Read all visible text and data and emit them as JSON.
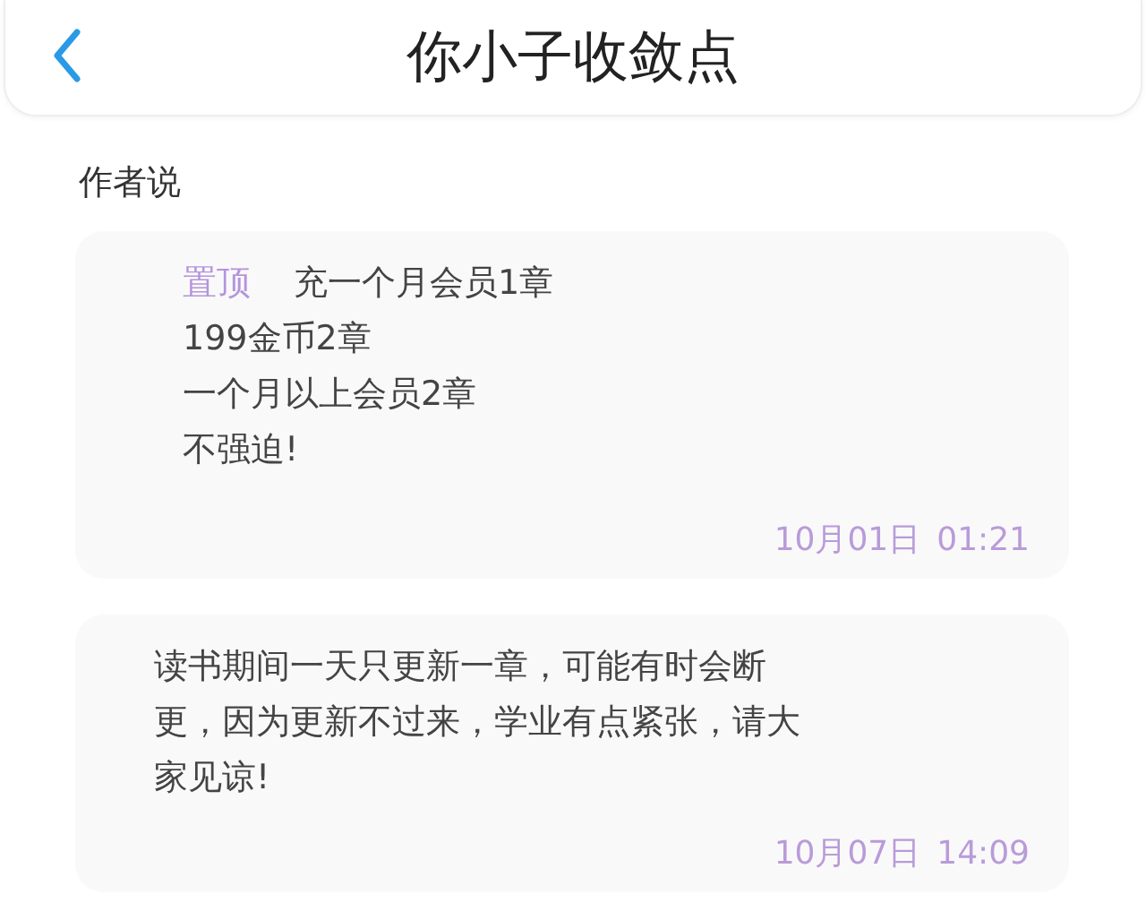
{
  "header": {
    "title": "你小子收敛点"
  },
  "section_title": "作者说",
  "posts": [
    {
      "pinned": true,
      "pin_label": "置顶",
      "lines": [
        "充一个月会员1章",
        "199金币2章",
        "一个月以上会员2章",
        "不强迫!"
      ],
      "date": "10月01日",
      "time": "01:21"
    },
    {
      "pinned": false,
      "lines": [
        "读书期间一天只更新一章，可能有时会断",
        "更，因为更新不过来，学业有点紧张，请大",
        "家见谅!"
      ],
      "date": "10月07日",
      "time": "14:09"
    }
  ]
}
